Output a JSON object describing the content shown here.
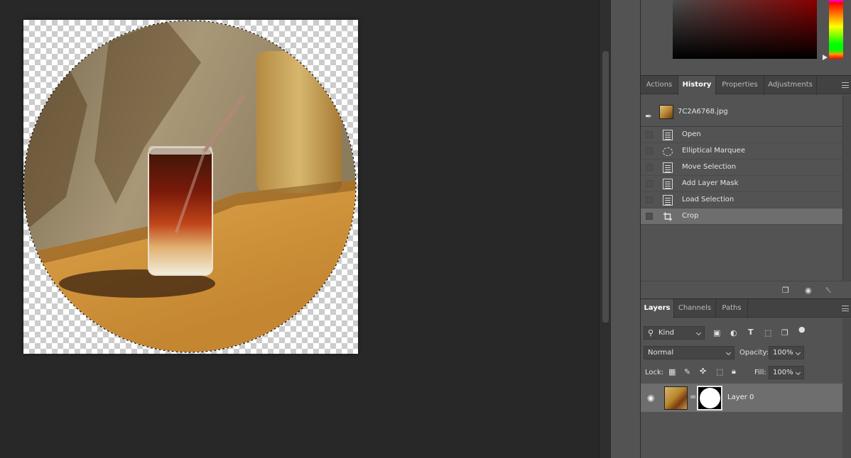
{
  "canvas": {
    "accent_colors": {
      "checker_light": "#ffffff",
      "checker_dark": "#cccccc"
    }
  },
  "color_panel": {
    "field_colors": [
      "#4a4a4a",
      "#8a0000",
      "#000000"
    ]
  },
  "history_tabs": [
    {
      "label": "Actions",
      "active": false
    },
    {
      "label": "History",
      "active": true
    },
    {
      "label": "Properties",
      "active": false
    },
    {
      "label": "Adjustments",
      "active": false
    }
  ],
  "history": {
    "snapshot_name": "7C2A6768.jpg",
    "snapshot_icon": "history-brush-icon",
    "items": [
      {
        "label": "Open",
        "icon": "document-icon"
      },
      {
        "label": "Elliptical Marquee",
        "icon": "elliptical-marquee-icon"
      },
      {
        "label": "Move Selection",
        "icon": "document-icon"
      },
      {
        "label": "Add Layer Mask",
        "icon": "document-icon"
      },
      {
        "label": "Load Selection",
        "icon": "document-icon"
      },
      {
        "label": "Crop",
        "icon": "crop-icon",
        "active": true
      }
    ],
    "footer_icons": [
      "new-document-from-state-icon",
      "camera-icon",
      "trash-icon"
    ]
  },
  "layers_tabs": [
    {
      "label": "Layers",
      "active": true
    },
    {
      "label": "Channels",
      "active": false
    },
    {
      "label": "Paths",
      "active": false
    }
  ],
  "layers": {
    "filter_kind": "Kind",
    "blend_mode": "Normal",
    "opacity_label": "Opacity:",
    "opacity_value": "100%",
    "lock_label": "Lock:",
    "fill_label": "Fill:",
    "fill_value": "100%",
    "layer_name": "Layer 0"
  }
}
